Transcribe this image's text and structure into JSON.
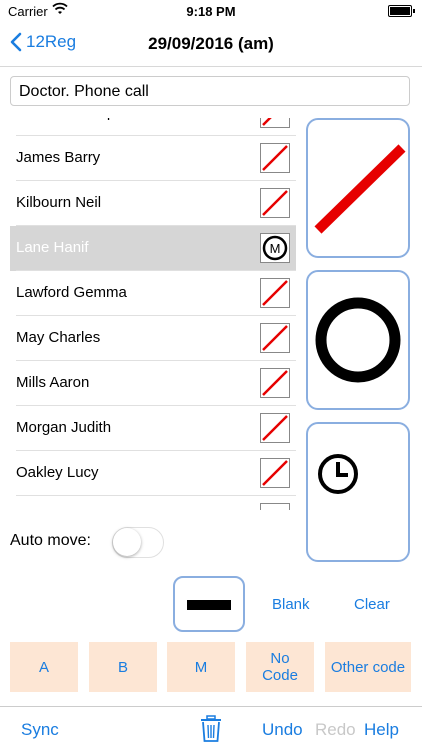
{
  "status": {
    "carrier": "Carrier",
    "time": "9:18 PM"
  },
  "nav": {
    "back_label": "12Reg",
    "title": "29/09/2016 (am)"
  },
  "session_title": "Doctor. Phone call",
  "list": {
    "rows": [
      {
        "name": "Hollander Stephen",
        "mark": "slash"
      },
      {
        "name": "James Barry",
        "mark": "slash"
      },
      {
        "name": "Kilbourn Neil",
        "mark": "slash"
      },
      {
        "name": "Lane Hanif",
        "mark": "M",
        "selected": true
      },
      {
        "name": "Lawford Gemma",
        "mark": "slash"
      },
      {
        "name": "May Charles",
        "mark": "slash"
      },
      {
        "name": "Mills Aaron",
        "mark": "slash"
      },
      {
        "name": "Morgan Judith",
        "mark": "slash"
      },
      {
        "name": "Oakley Lucy",
        "mark": "slash"
      }
    ]
  },
  "mark_buttons": [
    {
      "name": "present-slash-icon"
    },
    {
      "name": "absent-circle-icon"
    },
    {
      "name": "late-clock-icon"
    }
  ],
  "auto_move": {
    "label": "Auto move:",
    "on": false
  },
  "actions": {
    "blank": "Blank",
    "clear": "Clear"
  },
  "codes": [
    "A",
    "B",
    "M",
    "No Code",
    "Other code"
  ],
  "toolbar": {
    "sync": "Sync",
    "undo": "Undo",
    "redo": "Redo",
    "help": "Help"
  },
  "colors": {
    "accent": "#1a7de0",
    "slash": "#e60000",
    "code_bg": "#fde6d4",
    "button_border": "#8aaee0"
  }
}
